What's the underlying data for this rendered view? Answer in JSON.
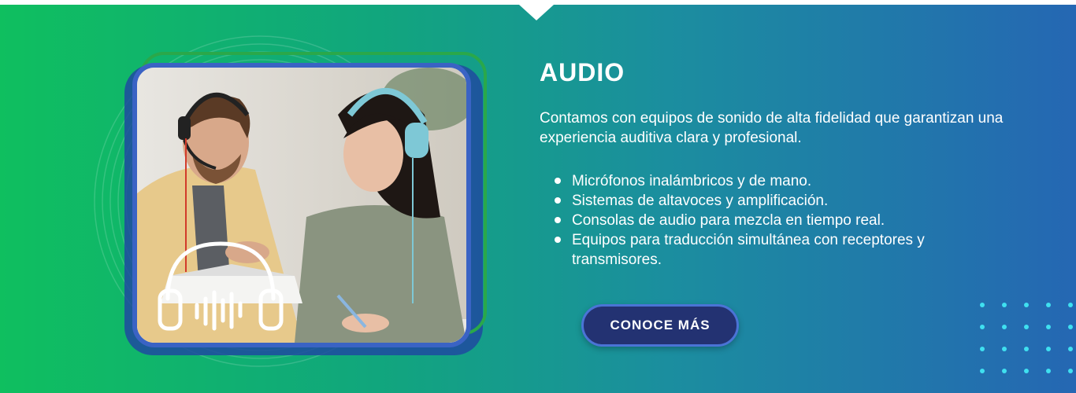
{
  "section": {
    "title": "AUDIO",
    "description": "Contamos con equipos de sonido de alta fidelidad que garantizan una experiencia auditiva clara y profesional.",
    "features": [
      "Micrófonos inalámbricos y de mano.",
      "Sistemas de altavoces y amplificación.",
      "Consolas de audio para mezcla en tiempo real.",
      "Equipos para traducción simultánea con receptores y transmisores."
    ],
    "cta_label": "CONOCE MÁS"
  },
  "image": {
    "subject": "two people wearing headphones reading a notebook",
    "overlay_icon": "headphones-soundwave-icon"
  },
  "colors": {
    "gradient_start": "#0fbf5f",
    "gradient_end": "#2567b3",
    "button_bg": "#233272",
    "button_border": "#4a74d6",
    "frame": "#3a63c4",
    "dots": "#3fe0f0"
  }
}
